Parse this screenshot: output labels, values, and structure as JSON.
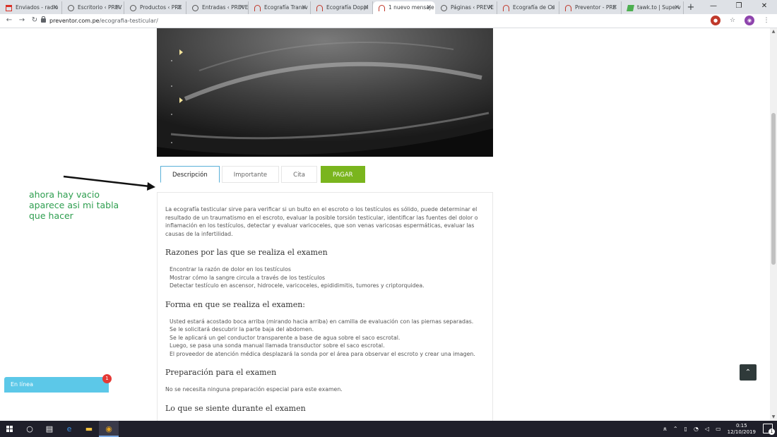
{
  "browser": {
    "tabs": [
      {
        "title": "Enviados - radio",
        "favicon": "gmail-icon"
      },
      {
        "title": "Escritorio ‹ PREV",
        "favicon": "wordpress-icon"
      },
      {
        "title": "Productos ‹ PRE",
        "favicon": "wordpress-icon"
      },
      {
        "title": "Entradas ‹ PREVE",
        "favicon": "wordpress-icon"
      },
      {
        "title": "Ecografía Transv",
        "favicon": "preventor-icon"
      },
      {
        "title": "Ecografía Doppl",
        "favicon": "preventor-icon"
      },
      {
        "title": "1 nuevo mensaje",
        "favicon": "preventor-icon",
        "active": true
      },
      {
        "title": "Páginas ‹ PREVE",
        "favicon": "wordpress-icon"
      },
      {
        "title": "Ecografía de Cu",
        "favicon": "preventor-icon"
      },
      {
        "title": "Preventor - PRE",
        "favicon": "preventor-icon"
      },
      {
        "title": "tawk.to | Superv",
        "favicon": "tawk-icon"
      }
    ],
    "url_domain": "preventor.com.pe",
    "url_path": "/ecografia-testicular/"
  },
  "page": {
    "tabs": {
      "descripcion": "Descripción",
      "importante": "Importante",
      "cita": "Cita",
      "pagar": "PAGAR"
    },
    "intro": "La ecografía testicular sirve para verificar si un bulto en el escroto o los testículos es sólido, puede determinar el resultado de un traumatismo en el escroto, evaluar la posible torsión testicular, identificar las fuentes del dolor o inflamación en los testículos, detectar y evaluar varicoceles, que son venas varicosas espermáticas, evaluar las causas de la infertilidad.",
    "section1": {
      "title": "Razones por las que se realiza el examen",
      "items": [
        "Encontrar la razón de dolor en los testículos",
        "Mostrar cómo la sangre circula a través de los testículos",
        "Detectar testículo en ascensor, hidrocele, varicoceles, epididimitis, tumores y criptorquidea."
      ]
    },
    "section2": {
      "title": "Forma en que se realiza el examen:",
      "items": [
        "Usted estará acostado boca arriba (mirando hacia arriba) en camilla de evaluación con las piernas separadas.",
        "Se le solicitará descubrir la parte baja del abdomen.",
        "Se le aplicará un gel conductor transparente a base de agua sobre el saco escrotal.",
        "Luego, se pasa una sonda manual llamada transductor sobre el saco escrotal.",
        "El proveedor de atención médica desplazará la sonda por el área para observar el escroto y crear una imagen."
      ]
    },
    "section3": {
      "title": "Preparación para el examen",
      "text": "No se necesita ninguna preparación especial para este examen."
    },
    "section4": {
      "title": "Lo que se siente durante el examen"
    },
    "annotation": "ahora hay vacio\naparece asi mi tabla\nque hacer",
    "chat_label": "En línea",
    "chat_badge": "1"
  },
  "taskbar": {
    "time": "0:15",
    "date": "12/10/2019",
    "notif_count": "1"
  },
  "colors": {
    "pay_button": "#7ab51d",
    "annotation": "#2e9e4f",
    "chat": "#5cc8e8",
    "active_tab_border": "#5ab0d8"
  }
}
